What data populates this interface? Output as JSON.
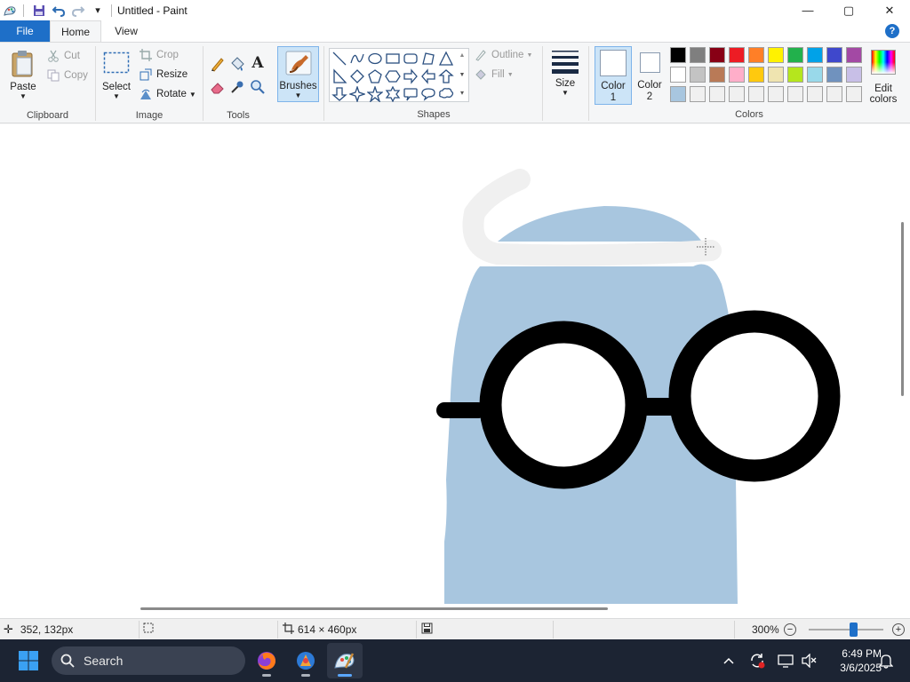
{
  "window": {
    "title": "Untitled - Paint",
    "qa_dropdown": "▾",
    "controls": {
      "minimize": "—",
      "maximize": "▢",
      "close": "✕"
    }
  },
  "tabs": {
    "file": "File",
    "home": "Home",
    "view": "View",
    "help": "?"
  },
  "ribbon": {
    "clipboard": {
      "paste": "Paste",
      "cut": "Cut",
      "copy": "Copy",
      "group": "Clipboard"
    },
    "image": {
      "select": "Select",
      "crop": "Crop",
      "resize": "Resize",
      "rotate": "Rotate",
      "group": "Image"
    },
    "tools": {
      "group": "Tools",
      "text_icon": "A"
    },
    "brushes": {
      "label": "Brushes"
    },
    "shapes": {
      "outline": "Outline",
      "fill": "Fill",
      "group": "Shapes",
      "icons": [
        "line",
        "curve",
        "oval",
        "rectangle",
        "rounded-rectangle",
        "polygon",
        "triangle",
        "right-triangle",
        "diamond",
        "pentagon",
        "hexagon",
        "right-arrow",
        "left-arrow",
        "up-arrow",
        "down-arrow",
        "four-point-star",
        "five-point-star",
        "six-point-star",
        "rounded-callout",
        "oval-callout",
        "cloud-callout"
      ]
    },
    "size": {
      "label": "Size"
    },
    "colors": {
      "color1_label": "Color 1",
      "color1_line1": "Color",
      "color1_line2": "1",
      "color2_line1": "Color",
      "color2_line2": "2",
      "edit_line1": "Edit",
      "edit_line2": "colors",
      "group": "Colors",
      "color1": "#ffffff",
      "color2": "#ffffff",
      "palette_row1": [
        "#000000",
        "#7f7f7f",
        "#880015",
        "#ed1c24",
        "#ff7f27",
        "#fff200",
        "#22b14c",
        "#00a2e8",
        "#3f48cc",
        "#a349a4"
      ],
      "palette_row2": [
        "#ffffff",
        "#c3c3c3",
        "#b97a57",
        "#ffaec9",
        "#ffc90e",
        "#efe4b0",
        "#b5e61d",
        "#99d9ea",
        "#7092be",
        "#c8bfe7"
      ],
      "palette_row3": [
        "#a8c6df",
        "#f0f0f0",
        "#f0f0f0",
        "#f0f0f0",
        "#f0f0f0",
        "#f0f0f0",
        "#f0f0f0",
        "#f0f0f0",
        "#f0f0f0",
        "#f0f0f0"
      ]
    }
  },
  "status": {
    "cursor_pos": "352, 132px",
    "canvas_size": "614 × 460px",
    "zoom": "300%"
  },
  "taskbar": {
    "search": "Search",
    "time": "6:49 PM",
    "date": "3/6/2025"
  },
  "drawing": {
    "body_color": "#a8c6df",
    "glasses_color": "#000000",
    "highlight_color": "#f0f0f0"
  }
}
